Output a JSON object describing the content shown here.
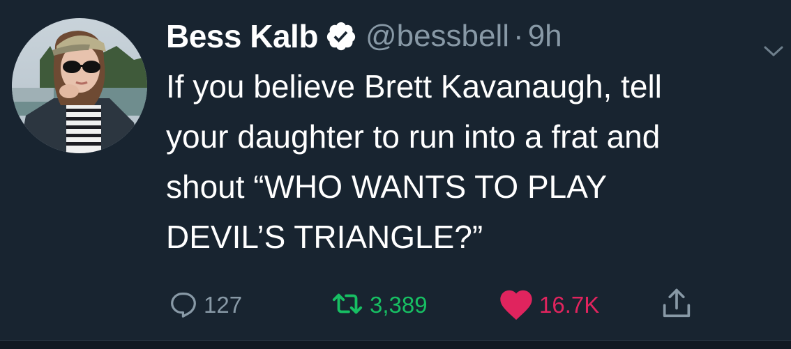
{
  "tweet": {
    "author": {
      "display_name": "Bess Kalb",
      "handle": "@bessbell",
      "verified": true
    },
    "separator": "·",
    "time": "9h",
    "text_lines": [
      "If you believe Brett Kavanaugh, tell",
      "your daughter to run into a frat and",
      "shout “WHO WANTS TO PLAY",
      "DEVIL’S TRIANGLE?”"
    ],
    "actions": {
      "reply_count": "127",
      "retweet_count": "3,389",
      "like_count": "16.7K"
    }
  },
  "icons": {
    "verified": "verified-badge-icon",
    "caret": "chevron-down-icon",
    "reply": "speech-bubble-icon",
    "retweet": "retweet-arrows-icon",
    "like": "heart-icon",
    "share": "share-upload-icon"
  },
  "colors": {
    "background": "#182430",
    "text_primary": "#ffffff",
    "text_secondary": "#8899a6",
    "retweet": "#17bf63",
    "like": "#e0245e"
  }
}
